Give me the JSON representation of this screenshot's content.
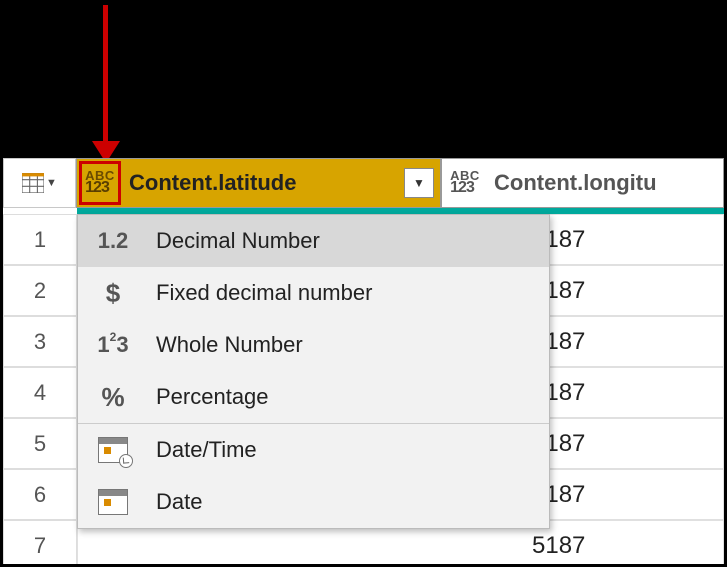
{
  "columns": [
    {
      "name": "Content.latitude",
      "type_icon": "any"
    },
    {
      "name": "Content.longitu",
      "type_icon": "any"
    }
  ],
  "row_numbers": [
    "1",
    "2",
    "3",
    "4",
    "5",
    "6",
    "7"
  ],
  "visible_cells_col2_fragment": [
    "5187",
    "5187",
    "5187",
    "5187",
    "5187",
    "5187",
    "5187"
  ],
  "abc_label_top": "ABC",
  "abc_label_bottom": "123",
  "menu": {
    "items": [
      {
        "icon": "decimal",
        "label": "Decimal Number",
        "hover": true
      },
      {
        "icon": "currency",
        "label": "Fixed decimal number"
      },
      {
        "icon": "whole",
        "label": "Whole Number"
      },
      {
        "icon": "percent",
        "label": "Percentage"
      },
      {
        "icon": "datetime",
        "label": "Date/Time"
      },
      {
        "icon": "date",
        "label": "Date"
      }
    ],
    "icon_text": {
      "decimal": "1.2",
      "currency": "$",
      "whole_main": "1",
      "whole_sup": "2",
      "whole_tail": "3",
      "percent": "%"
    }
  }
}
